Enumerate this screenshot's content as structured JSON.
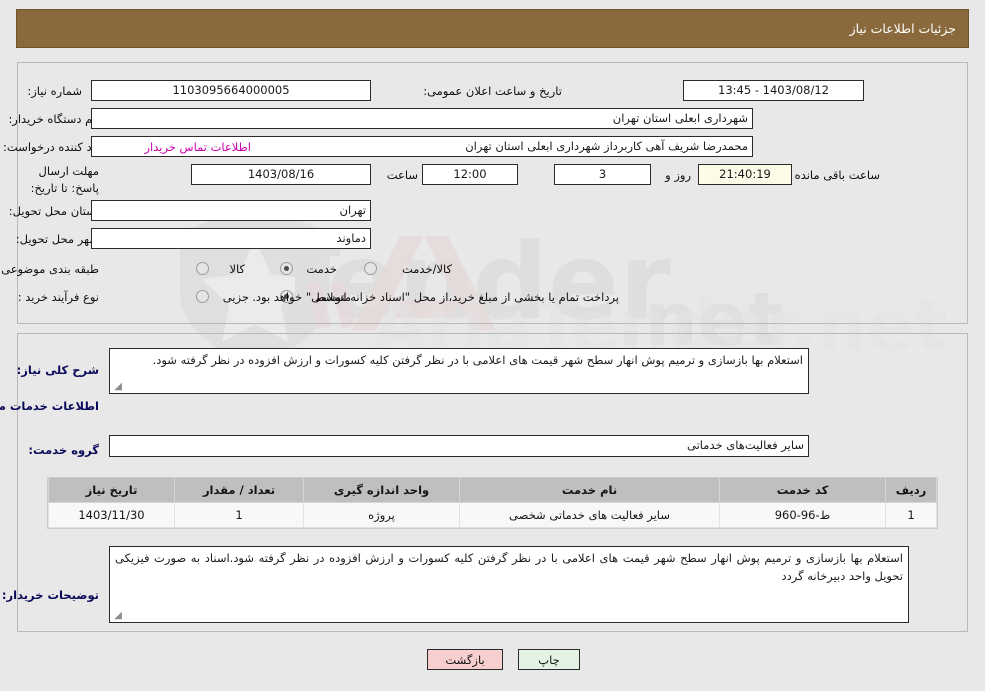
{
  "header": {
    "title": "جزئیات اطلاعات نیاز"
  },
  "top_section": {
    "need_number_label": "شماره نیاز:",
    "need_number_value": "1103095664000005",
    "public_announce_label": "تاریخ و ساعت اعلان عمومی:",
    "public_announce_value": "1403/08/12 - 13:45",
    "buyer_org_label": "نام دستگاه خریدار:",
    "buyer_org_value": "شهرداری ابعلی استان تهران",
    "requester_label": "ایجاد کننده درخواست:",
    "requester_value": "محمدرضا شریف آهی کاربرداز  شهرداری ابعلی استان تهران",
    "contact_link": "اطلاعات تماس خریدار",
    "deadline_label": "مهلت ارسال پاسخ: تا تاریخ:",
    "deadline_date": "1403/08/16",
    "hour_label": "ساعت",
    "deadline_time": "12:00",
    "days_remaining": "3",
    "days_unit_label": "روز و",
    "countdown": "21:40:19",
    "countdown_suffix_label": "ساعت باقی مانده",
    "province_label": "استان محل تحویل:",
    "province_value": "تهران",
    "city_label": "شهر محل تحویل:",
    "city_value": "دماوند",
    "category_label": "طبقه بندی موضوعی:",
    "category_options": [
      "کالا",
      "خدمت",
      "کالا/خدمت"
    ],
    "category_selected_index": 1,
    "process_label": "نوع فرآیند خرید :",
    "process_options": [
      "جزیی",
      "متوسط"
    ],
    "process_selected_index": 1,
    "treasury_note": "پرداخت تمام یا بخشی از مبلغ خرید،از محل \"اسناد خزانه اسلامی\" خواهد بود."
  },
  "bottom_section": {
    "general_desc_label": "شرح کلی نیاز:",
    "general_desc_value": "استعلام بها بازسازی و ترمیم پوش انهار سطح شهر قیمت های اعلامی با در نظر گرفتن کلیه کسورات و ارزش افزوده در نظر گرفته شود.",
    "services_info_heading": "اطلاعات خدمات مورد نیاز",
    "service_group_label": "گروه خدمت:",
    "service_group_value": "سایر فعالیت‌های خدماتی",
    "buyer_notes_label": "توضیحات خریدار:",
    "buyer_notes_value": "استعلام بها بازسازی و ترمیم پوش انهار سطح شهر قیمت های اعلامی با در نظر گرفتن کلیه کسورات و ارزش افزوده در نظر گرفته شود.اسناد به صورت فیزیکی تحویل واحد دبیرخانه گردد"
  },
  "table": {
    "columns": [
      "ردیف",
      "کد خدمت",
      "نام خدمت",
      "واحد اندازه گیری",
      "تعداد / مقدار",
      "تاریخ نیاز"
    ],
    "rows": [
      {
        "row_no": "1",
        "service_code": "ط-96-960",
        "service_name": "سایر فعالیت های خدماتی شخصی",
        "unit": "پروژه",
        "quantity": "1",
        "need_date": "1403/11/30"
      }
    ]
  },
  "footer": {
    "back_label": "بازگشت",
    "print_label": "چاپ"
  },
  "watermark": {
    "text": "AriaTender.net"
  },
  "colors": {
    "header_bg": "#8a6a3d",
    "page_bg": "#e8e8e8",
    "link": "#cc00aa",
    "countdown_bg": "#fbfbe7",
    "back_btn_bg": "#f8cfcf",
    "print_btn_bg": "#e3f3e3",
    "table_header_bg": "#bfbfbf"
  }
}
